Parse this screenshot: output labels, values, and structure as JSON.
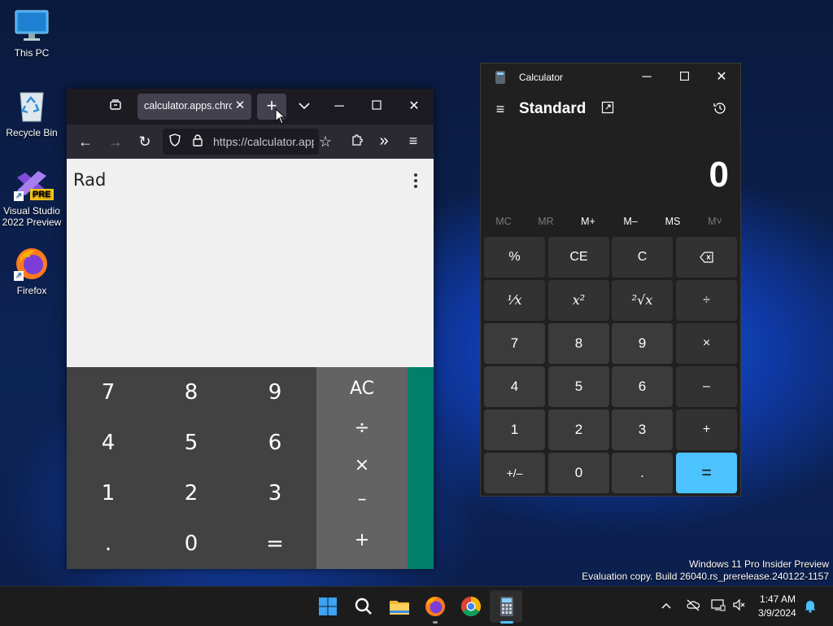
{
  "desktop": {
    "icons": [
      {
        "label": "This PC"
      },
      {
        "label": "Recycle Bin"
      },
      {
        "label": "Visual Studio 2022 Preview",
        "badge": "PRE"
      },
      {
        "label": "Firefox"
      }
    ],
    "watermark": {
      "line1": "Windows 11 Pro Insider Preview",
      "line2": "Evaluation copy. Build 26040.rs_prerelease.240122-1157"
    }
  },
  "firefox": {
    "tab_title": "calculator.apps.chrome",
    "url": "https://calculator.apps.chrome",
    "web_calc": {
      "mode": "Rad",
      "num_keys": [
        [
          "7",
          "8",
          "9"
        ],
        [
          "4",
          "5",
          "6"
        ],
        [
          "1",
          "2",
          "3"
        ],
        [
          ".",
          "0",
          "="
        ]
      ],
      "op_keys": [
        "AC",
        "÷",
        "×",
        "–",
        "+"
      ]
    }
  },
  "calculator": {
    "title": "Calculator",
    "mode": "Standard",
    "display": "0",
    "memory": [
      "MC",
      "MR",
      "M+",
      "M–",
      "MS",
      "M˅"
    ],
    "keys": [
      [
        "%",
        "CE",
        "C",
        "⌫"
      ],
      [
        "⅟x",
        "x²",
        "²√x",
        "÷"
      ],
      [
        "7",
        "8",
        "9",
        "×"
      ],
      [
        "4",
        "5",
        "6",
        "–"
      ],
      [
        "1",
        "2",
        "3",
        "+"
      ],
      [
        "+/–",
        "0",
        ".",
        "="
      ]
    ]
  },
  "taskbar": {
    "time": "1:47 AM",
    "date": "3/9/2024"
  },
  "colors": {
    "accent": "#4cc2ff",
    "web_calc_green": "#00806a"
  }
}
